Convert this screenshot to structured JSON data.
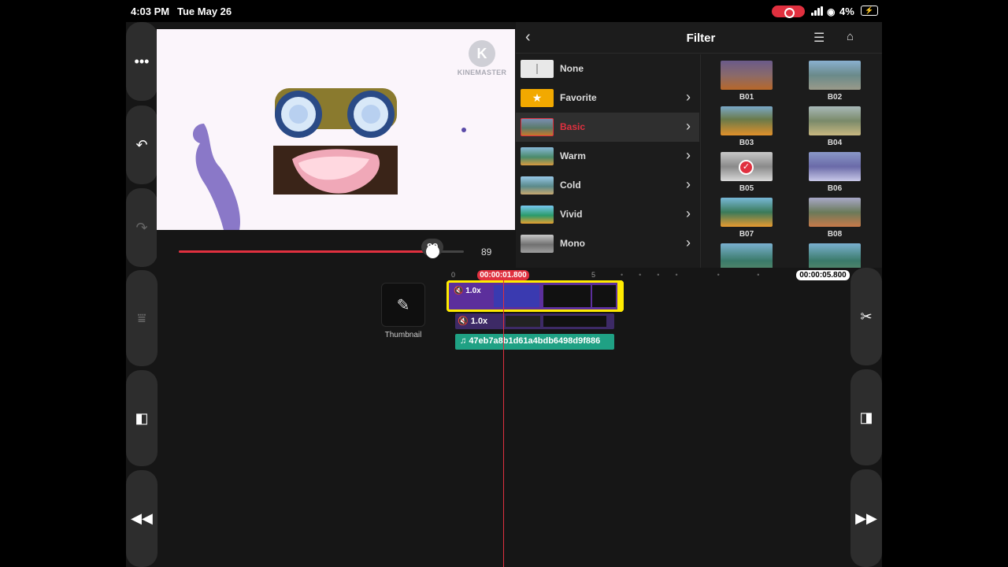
{
  "status": {
    "time": "4:03 PM",
    "date": "Tue May 26",
    "battery": "4%"
  },
  "preview": {
    "logo_text": "KINEMASTER",
    "logo_letter": "K"
  },
  "scrubber": {
    "bubble_value": "89",
    "value_label": "89",
    "fraction": 0.89
  },
  "filter_panel": {
    "title": "Filter",
    "categories": [
      {
        "label": "None",
        "selected": false
      },
      {
        "label": "Favorite",
        "selected": false
      },
      {
        "label": "Basic",
        "selected": true
      },
      {
        "label": "Warm",
        "selected": false
      },
      {
        "label": "Cold",
        "selected": false
      },
      {
        "label": "Vivid",
        "selected": false
      },
      {
        "label": "Mono",
        "selected": false
      }
    ],
    "filters": [
      {
        "label": "B01"
      },
      {
        "label": "B02"
      },
      {
        "label": "B03"
      },
      {
        "label": "B04"
      },
      {
        "label": "B05",
        "selected": true
      },
      {
        "label": "B06"
      },
      {
        "label": "B07"
      },
      {
        "label": "B08"
      }
    ]
  },
  "timeline": {
    "playhead_time": "00:00:01.800",
    "end_time": "00:00:05.800",
    "ruler_labels": [
      "0",
      "5"
    ],
    "thumbnail_label": "Thumbnail",
    "main_clip_speed": "1.0x",
    "layer_speed": "1.0x",
    "audio_name": "47eb7a8b1d61a4bdb6498d9f886"
  },
  "colors": {
    "accent": "#e0303f",
    "clip_border": "#ffeb00",
    "audio": "#1fa184"
  },
  "icons": {
    "left_rail": [
      "more-icon",
      "undo-icon",
      "redo-icon",
      "layer-icon",
      "split-left-icon",
      "rewind-icon"
    ],
    "right_rail": [
      "scissors-icon",
      "split-right-icon",
      "forward-icon"
    ]
  }
}
